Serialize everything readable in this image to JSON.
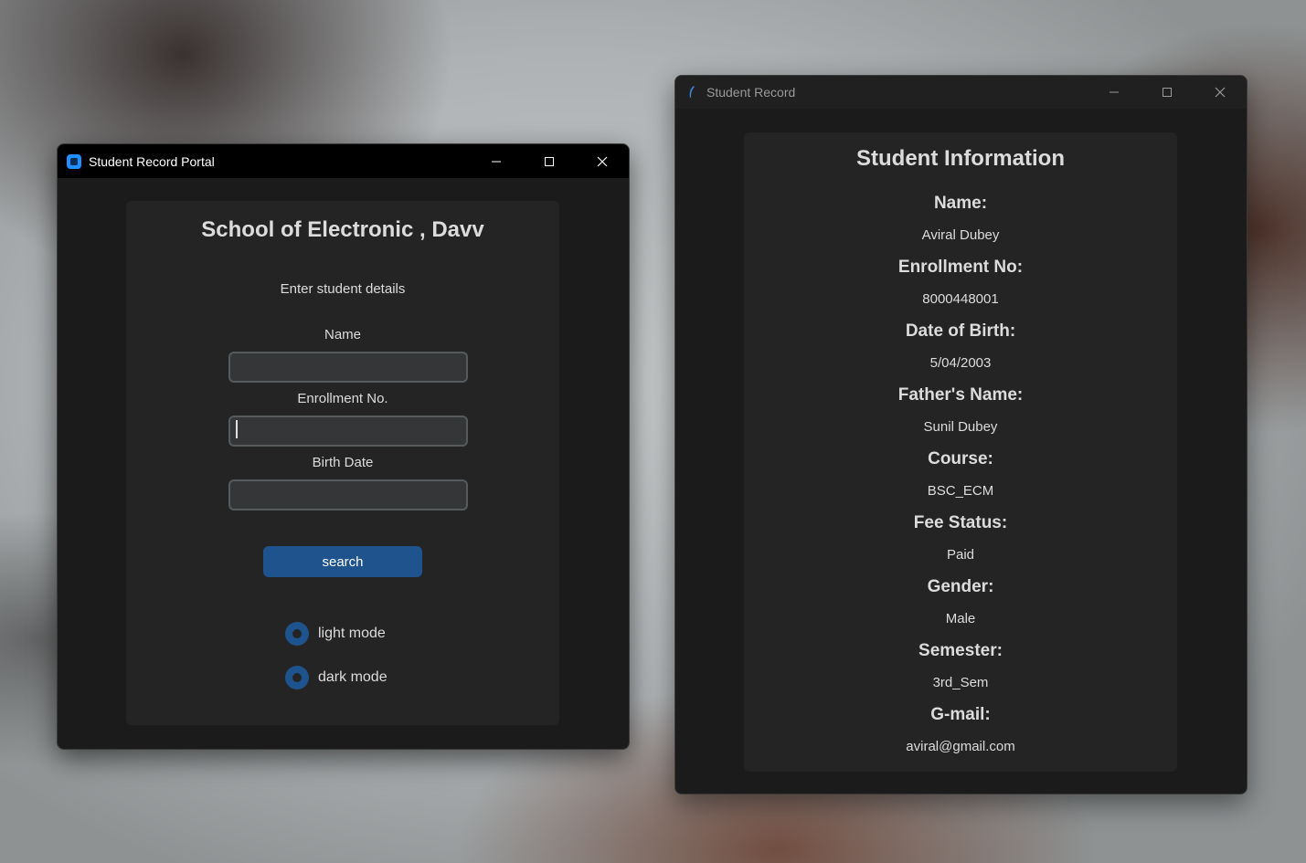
{
  "portal": {
    "title": "Student Record Portal",
    "heading": "School of Electronic , Davv",
    "subtitle": "Enter student details",
    "fields": [
      {
        "label": "Name",
        "value": ""
      },
      {
        "label": "Enrollment No.",
        "value": ""
      },
      {
        "label": "Birth Date",
        "value": ""
      }
    ],
    "search_label": "search",
    "modes": [
      {
        "label": "light mode"
      },
      {
        "label": "dark mode"
      }
    ]
  },
  "record": {
    "title": "Student Record",
    "heading": "Student Information",
    "rows": [
      {
        "label": "Name:",
        "value": "Aviral Dubey"
      },
      {
        "label": "Enrollment No:",
        "value": "8000448001"
      },
      {
        "label": "Date of Birth:",
        "value": "5/04/2003"
      },
      {
        "label": "Father's Name:",
        "value": "Sunil Dubey"
      },
      {
        "label": "Course:",
        "value": "BSC_ECM"
      },
      {
        "label": "Fee Status:",
        "value": "Paid"
      },
      {
        "label": "Gender:",
        "value": "Male"
      },
      {
        "label": "Semester:",
        "value": "3rd_Sem"
      },
      {
        "label": "G-mail:",
        "value": "aviral@gmail.com"
      }
    ]
  },
  "colors": {
    "accent": "#1f538d",
    "card": "#242424",
    "window": "#1b1b1b",
    "text": "#dcdcdc"
  }
}
